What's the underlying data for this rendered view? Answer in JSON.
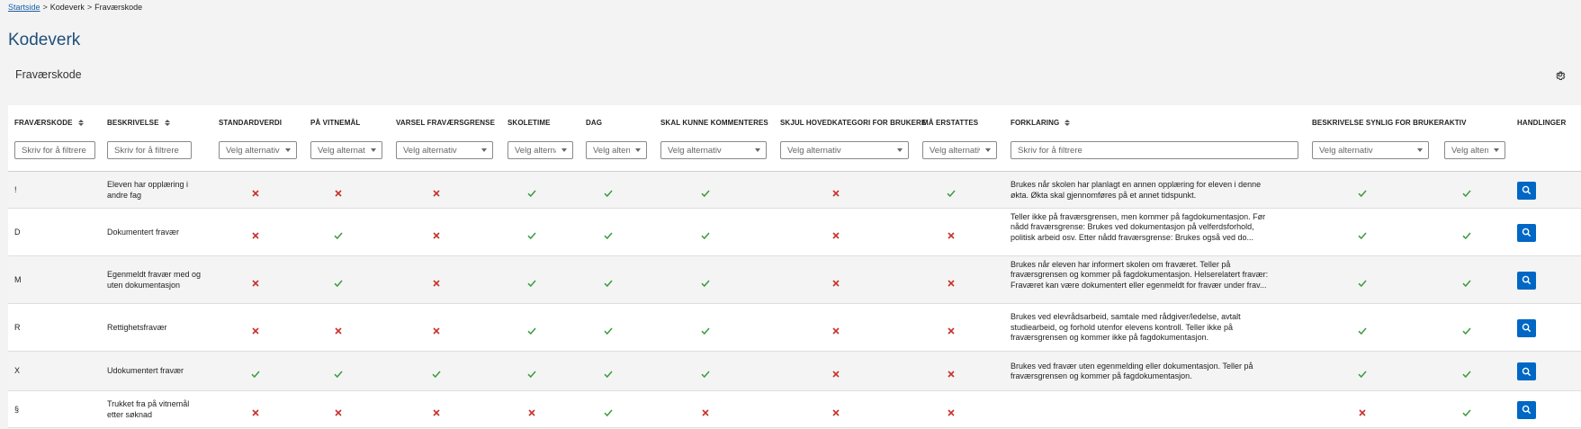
{
  "breadcrumb": {
    "home": "Startside",
    "level2": "Kodeverk",
    "current": "Fraværskode"
  },
  "page_title": "Kodeverk",
  "section_title": "Fraværskode",
  "columns": {
    "kode": "FRAVÆRSKODE",
    "beskrivelse": "BESKRIVELSE",
    "standardverdi": "STANDARDVERDI",
    "vitnemal": "PÅ VITNEMÅL",
    "varsel": "VARSEL FRAVÆRSGRENSE",
    "skoletime": "SKOLETIME",
    "dag": "DAG",
    "kommentere": "SKAL KUNNE KOMMENTERES",
    "skjul": "SKJUL HOVEDKATEGORI FOR BRUKERE",
    "erstattes": "MÅ ERSTATTES",
    "forklaring": "FORKLARING",
    "synlig": "BESKRIVELSE SYNLIG FOR BRUKER",
    "aktiv": "AKTIV",
    "handlinger": "HANDLINGER"
  },
  "filters": {
    "text_placeholder": "Skriv for å filtrere",
    "select_placeholder": "Velg alternativ"
  },
  "rows": [
    {
      "kode": "!",
      "beskrivelse": "Eleven har opplæring i andre fag",
      "standardverdi": false,
      "vitnemal": false,
      "varsel": false,
      "skoletime": true,
      "dag": true,
      "kommentere": true,
      "skjul": false,
      "erstattes": true,
      "forklaring": "Brukes når skolen har planlagt en annen opplæring for eleven i denne økta. Økta skal gjennomføres på et annet tidspunkt.",
      "synlig": true,
      "aktiv": true
    },
    {
      "kode": "D",
      "beskrivelse": "Dokumentert fravær",
      "standardverdi": false,
      "vitnemal": true,
      "varsel": false,
      "skoletime": true,
      "dag": true,
      "kommentere": true,
      "skjul": false,
      "erstattes": false,
      "forklaring": "Teller ikke på fraværsgrensen, men kommer på fagdokumentasjon. Før nådd fraværsgrense: Brukes ved dokumentasjon på velferdsforhold, politisk arbeid osv. Etter nådd fraværsgrense: Brukes også ved do...",
      "synlig": true,
      "aktiv": true
    },
    {
      "kode": "M",
      "beskrivelse": "Egenmeldt fravær med og uten dokumentasjon",
      "standardverdi": false,
      "vitnemal": true,
      "varsel": false,
      "skoletime": true,
      "dag": true,
      "kommentere": true,
      "skjul": false,
      "erstattes": false,
      "forklaring": "Brukes når eleven har informert skolen om fraværet. Teller på fraværsgrensen og kommer på fagdokumentasjon. Helserelatert fravær: Fraværet kan være dokumentert eller egenmeldt for fravær under frav...",
      "synlig": true,
      "aktiv": true
    },
    {
      "kode": "R",
      "beskrivelse": "Rettighetsfravær",
      "standardverdi": false,
      "vitnemal": false,
      "varsel": false,
      "skoletime": true,
      "dag": true,
      "kommentere": true,
      "skjul": false,
      "erstattes": false,
      "forklaring": "Brukes ved elevrådsarbeid, samtale med rådgiver/ledelse, avtalt studiearbeid, og forhold utenfor elevens kontroll. Teller ikke på fraværsgrensen og kommer ikke på fagdokumentasjon.",
      "synlig": true,
      "aktiv": true
    },
    {
      "kode": "X",
      "beskrivelse": "Udokumentert fravær",
      "standardverdi": true,
      "vitnemal": true,
      "varsel": true,
      "skoletime": true,
      "dag": true,
      "kommentere": true,
      "skjul": false,
      "erstattes": false,
      "forklaring": "Brukes ved fravær uten egenmelding eller dokumentasjon. Teller på fraværsgrensen og kommer på fagdokumentasjon.",
      "synlig": true,
      "aktiv": true
    },
    {
      "kode": "§",
      "beskrivelse": "Trukket fra på vitnemål etter søknad",
      "standardverdi": false,
      "vitnemal": false,
      "varsel": false,
      "skoletime": false,
      "dag": true,
      "kommentere": false,
      "skjul": false,
      "erstattes": false,
      "forklaring": "",
      "synlig": false,
      "aktiv": true
    }
  ],
  "colors": {
    "check": "#3c9b3c",
    "cross": "#c8312b",
    "button": "#0067c5",
    "title": "#1f4f7a",
    "link": "#1a5fa8"
  },
  "icons": {
    "check": "check-icon",
    "cross": "cross-icon",
    "search": "search-icon",
    "settings": "gear-icon",
    "sort": "sort-icon",
    "caret": "chevron-down-icon"
  }
}
